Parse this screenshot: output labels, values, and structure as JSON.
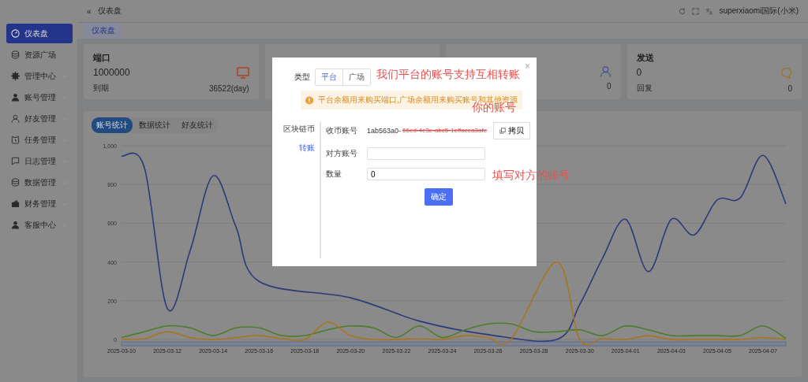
{
  "sidebar": {
    "items": [
      {
        "label": "仪表盘",
        "kind": "dashboard",
        "selected": true,
        "expandable": false
      },
      {
        "label": "资源广场",
        "kind": "database",
        "selected": false,
        "expandable": false
      },
      {
        "label": "管理中心",
        "kind": "gear",
        "selected": false,
        "expandable": true
      },
      {
        "label": "账号管理",
        "kind": "person",
        "selected": false,
        "expandable": true
      },
      {
        "label": "好友管理",
        "kind": "person-outline",
        "selected": false,
        "expandable": true
      },
      {
        "label": "任务管理",
        "kind": "alarm",
        "selected": false,
        "expandable": true
      },
      {
        "label": "日志管理",
        "kind": "chat",
        "selected": false,
        "expandable": true
      },
      {
        "label": "数据管理",
        "kind": "database",
        "selected": false,
        "expandable": true
      },
      {
        "label": "财务管理",
        "kind": "wallet",
        "selected": false,
        "expandable": true
      },
      {
        "label": "客服中心",
        "kind": "person",
        "selected": false,
        "expandable": true
      }
    ]
  },
  "header": {
    "collapse": "«",
    "breadcrumb": "仪表盘",
    "user": "superxiaomi国际(小米)"
  },
  "tabs": [
    {
      "label": "仪表盘",
      "selected": true
    }
  ],
  "cards": [
    {
      "kind": "monitor",
      "title": "端口",
      "value": "1000000",
      "color": "#a5533a",
      "sub_label": "到期",
      "sub_value": "36522(day)"
    },
    {
      "kind": "hidden"
    },
    {
      "kind": "person",
      "color": "#4a4f95",
      "sub_value": "0"
    },
    {
      "kind": "chat",
      "title": "发送",
      "value": "0",
      "color": "#9c7226",
      "sub_label": "回复",
      "sub_value": "0"
    }
  ],
  "chart_tabs": [
    {
      "label": "账号统计",
      "selected": true
    },
    {
      "label": "数据统计",
      "selected": false
    },
    {
      "label": "好友统计",
      "selected": false
    }
  ],
  "chart_data": {
    "type": "line",
    "categories": [
      "2025-03-10",
      null,
      "2025-03-12",
      null,
      "2025-03-14",
      null,
      "2025-03-16",
      null,
      "2025-03-18",
      null,
      "2025-03-20",
      null,
      "2025-03-22",
      null,
      "2025-03-24",
      null,
      "2025-03-26",
      null,
      "2025-03-28",
      null,
      "2025-03-30",
      null,
      "2025-04-01",
      null,
      "2025-04-03",
      null,
      "2025-04-05",
      null,
      "2025-04-07",
      null
    ],
    "yticks": [
      0,
      200,
      400,
      600,
      800,
      {
        "value": 1000,
        "label": "1,000"
      }
    ],
    "ylim": [
      0,
      1000
    ],
    "grid": true,
    "series": [
      {
        "color": "#2c3a7a",
        "values": [
          947,
          886,
          160,
          460,
          845,
          580,
          300,
          null,
          null,
          null,
          215,
          null,
          null,
          95,
          null,
          null,
          25,
          null,
          null,
          0,
          180,
          420,
          620,
          350,
          620,
          540,
          720,
          730,
          950,
          700
        ]
      },
      {
        "color": "#4c7d2a",
        "values": [
          10,
          40,
          70,
          60,
          20,
          60,
          60,
          20,
          20,
          50,
          70,
          60,
          10,
          70,
          10,
          50,
          80,
          80,
          40,
          40,
          50,
          20,
          70,
          50,
          20,
          20,
          20,
          20,
          70,
          5
        ]
      },
      {
        "color": "#a8761f",
        "values": [
          0,
          5,
          40,
          10,
          0,
          10,
          20,
          5,
          0,
          90,
          20,
          0,
          0,
          5,
          0,
          20,
          10,
          0,
          null,
          400,
          0,
          5,
          0,
          20,
          0,
          0,
          0,
          0,
          10,
          0
        ]
      }
    ]
  },
  "modal": {
    "close": "×",
    "type_label": "类型",
    "type_options": [
      {
        "label": "平台",
        "selected": true
      },
      {
        "label": "广场",
        "selected": false
      }
    ],
    "notice": "平台余额用来购买端口,广场余额用来购买账号和其他资源",
    "side_tabs": [
      {
        "label": "区块链币",
        "selected": false
      },
      {
        "label": "转账",
        "selected": true
      }
    ],
    "fields": [
      {
        "kind": "text",
        "label": "收币账号",
        "value": "1ab563a0-",
        "redacted": "66ed-4e3e-abc5-1effacea3afe",
        "action": "拷贝"
      },
      {
        "kind": "input",
        "label": "对方账号"
      },
      {
        "kind": "input",
        "label": "数量",
        "value": "0"
      }
    ],
    "submit": "确定"
  },
  "annotations": [
    {
      "text": "我们平台的账号支持互相转账"
    },
    {
      "text": "你的账号"
    },
    {
      "text": "填写对方的账号"
    }
  ]
}
